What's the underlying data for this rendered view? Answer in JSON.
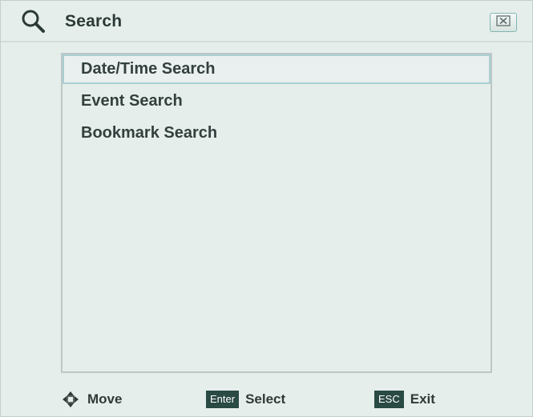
{
  "window": {
    "title": "Search",
    "title_icon": "magnifier-icon",
    "close_icon": "close-x-icon"
  },
  "menu": {
    "items": [
      {
        "label": "Date/Time Search",
        "selected": true
      },
      {
        "label": "Event Search",
        "selected": false
      },
      {
        "label": "Bookmark Search",
        "selected": false
      }
    ]
  },
  "footer": {
    "move": {
      "icon": "four-way-arrow-icon",
      "label": "Move"
    },
    "select": {
      "key": "Enter",
      "label": "Select"
    },
    "exit": {
      "key": "ESC",
      "label": "Exit"
    }
  },
  "colors": {
    "background": "#e6eeeb",
    "selection_border": "#a9cfd3",
    "key_badge": "#2a4a44",
    "text": "#33403d"
  }
}
